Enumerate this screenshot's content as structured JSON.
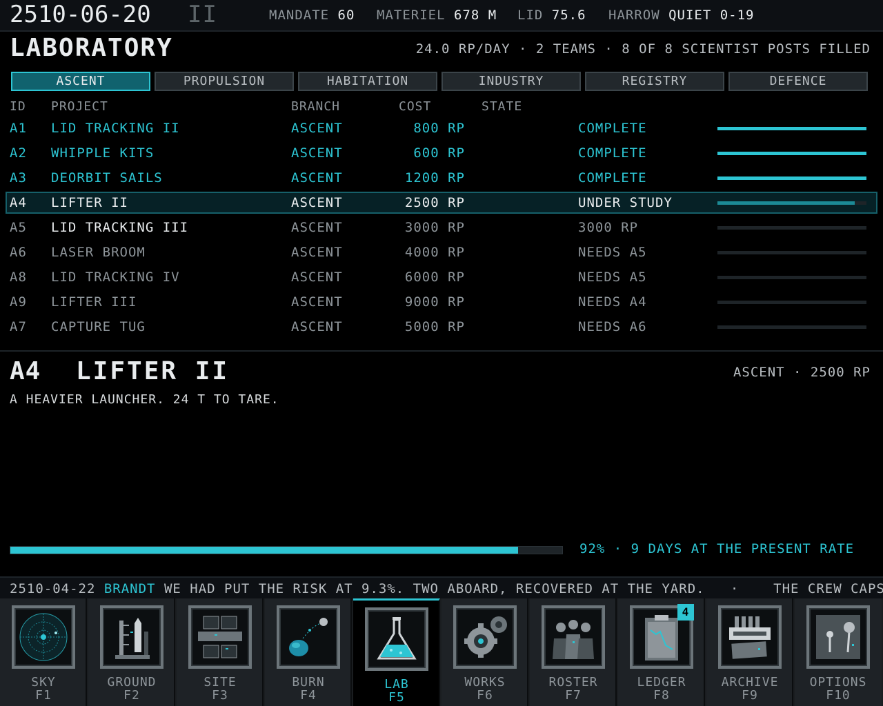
{
  "header": {
    "date": "2510-06-20",
    "phase": "II",
    "stats": [
      {
        "label": "MANDATE",
        "value": "60"
      },
      {
        "label": "MATERIEL",
        "value": "678 M"
      },
      {
        "label": "LID",
        "value": "75.6"
      },
      {
        "label": "HARROW",
        "value": "QUIET 0-19"
      }
    ]
  },
  "page": {
    "title": "LABORATORY",
    "summary": "24.0 RP/DAY · 2 TEAMS · 8 OF 8 SCIENTIST POSTS FILLED"
  },
  "tabs": [
    "ASCENT",
    "PROPULSION",
    "HABITATION",
    "INDUSTRY",
    "REGISTRY",
    "DEFENCE"
  ],
  "active_tab": 0,
  "table": {
    "headers": {
      "id": "ID",
      "project": "PROJECT",
      "branch": "BRANCH",
      "cost": "COST",
      "state": "STATE"
    },
    "rows": [
      {
        "id": "A1",
        "name": "LID TRACKING II",
        "branch": "ASCENT",
        "cost": "800 RP",
        "state": "COMPLETE",
        "progress": 1.0,
        "status": "complete"
      },
      {
        "id": "A2",
        "name": "WHIPPLE KITS",
        "branch": "ASCENT",
        "cost": "600 RP",
        "state": "COMPLETE",
        "progress": 1.0,
        "status": "complete"
      },
      {
        "id": "A3",
        "name": "DEORBIT SAILS",
        "branch": "ASCENT",
        "cost": "1200 RP",
        "state": "COMPLETE",
        "progress": 1.0,
        "status": "complete"
      },
      {
        "id": "A4",
        "name": "LIFTER II",
        "branch": "ASCENT",
        "cost": "2500 RP",
        "state": "UNDER STUDY",
        "progress": 0.92,
        "status": "selected"
      },
      {
        "id": "A5",
        "name": "LID TRACKING III",
        "branch": "ASCENT",
        "cost": "3000 RP",
        "state": "3000 RP",
        "progress": 0,
        "status": "available"
      },
      {
        "id": "A6",
        "name": "LASER BROOM",
        "branch": "ASCENT",
        "cost": "4000 RP",
        "state": "NEEDS A5",
        "progress": 0,
        "status": "locked"
      },
      {
        "id": "A8",
        "name": "LID TRACKING IV",
        "branch": "ASCENT",
        "cost": "6000 RP",
        "state": "NEEDS A5",
        "progress": 0,
        "status": "locked"
      },
      {
        "id": "A9",
        "name": "LIFTER III",
        "branch": "ASCENT",
        "cost": "9000 RP",
        "state": "NEEDS A4",
        "progress": 0,
        "status": "locked"
      },
      {
        "id": "A7",
        "name": "CAPTURE TUG",
        "branch": "ASCENT",
        "cost": "5000 RP",
        "state": "NEEDS A6",
        "progress": 0,
        "status": "locked"
      }
    ]
  },
  "detail": {
    "id": "A4",
    "name": "LIFTER II",
    "meta": "ASCENT · 2500 RP",
    "description": "A HEAVIER LAUNCHER. 24 T TO TARE.",
    "progress": 0.92,
    "progress_text": "92% · 9 DAYS AT THE PRESENT RATE"
  },
  "ticker": {
    "date": "2510-04-22",
    "speaker": "BRANDT",
    "message": "WE HAD PUT THE RISK AT 9.3%. TWO ABOARD, RECOVERED AT THE YARD.",
    "separator": "·",
    "next": "THE CREW CAPSUL"
  },
  "dock": [
    {
      "label": "SKY",
      "key": "F1",
      "icon": "radar-icon"
    },
    {
      "label": "GROUND",
      "key": "F2",
      "icon": "launch-tower-icon"
    },
    {
      "label": "SITE",
      "key": "F3",
      "icon": "station-icon"
    },
    {
      "label": "BURN",
      "key": "F4",
      "icon": "orbit-icon"
    },
    {
      "label": "LAB",
      "key": "F5",
      "icon": "flask-icon"
    },
    {
      "label": "WORKS",
      "key": "F6",
      "icon": "gears-icon"
    },
    {
      "label": "ROSTER",
      "key": "F7",
      "icon": "crew-icon"
    },
    {
      "label": "LEDGER",
      "key": "F8",
      "icon": "clipboard-chart-icon",
      "badge": "4"
    },
    {
      "label": "ARCHIVE",
      "key": "F9",
      "icon": "archive-icon"
    },
    {
      "label": "OPTIONS",
      "key": "F10",
      "icon": "joystick-icon"
    }
  ],
  "active_dock": 4,
  "colors": {
    "accent": "#2dc5d3",
    "text": "#b9bec2",
    "bright": "#e9ecee",
    "muted": "#8e959a"
  }
}
